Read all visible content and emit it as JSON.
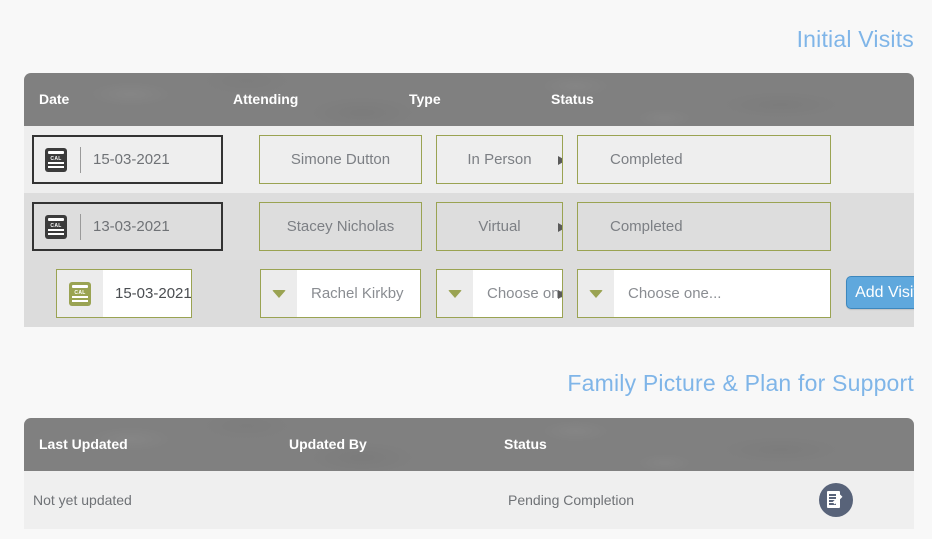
{
  "theme": {
    "page_background": "#f8f8f8",
    "heading_color": "#7fb5e8",
    "table_header_background": "#808080",
    "row_background_odd": "#eeeeee",
    "row_background_even": "#dddddd",
    "field_border_green": "#9aa352",
    "field_border_dark": "#333333",
    "primary_button_background": "#5fa8dd",
    "edit_icon_background": "#586379",
    "text_muted": "#7c7f84"
  },
  "initial_visits": {
    "heading": "Initial Visits",
    "columns": [
      "Date",
      "Attending",
      "Type",
      "Status"
    ],
    "rows": [
      {
        "date": "15-03-2021",
        "attending": "Simone Dutton",
        "type": "In Person",
        "status": "Completed",
        "date_icon": "calendar-icon",
        "date_icon_label": "CAL"
      },
      {
        "date": "13-03-2021",
        "attending": "Stacey Nicholas",
        "type": "Virtual",
        "status": "Completed",
        "date_icon": "calendar-icon",
        "date_icon_label": "CAL"
      }
    ],
    "new_row": {
      "date": "15-03-2021",
      "date_icon": "calendar-icon",
      "date_icon_label": "CAL",
      "attending": "Rachel Kirkby",
      "type": "Choose one",
      "status": "Choose one...",
      "dropdown_icon": "chevron-down-icon",
      "add_button_label": "Add Visit"
    }
  },
  "family_picture": {
    "heading": "Family Picture & Plan for Support",
    "columns": [
      "Last Updated",
      "Updated By",
      "Status"
    ],
    "rows": [
      {
        "last_updated": "Not yet updated",
        "updated_by": "",
        "status": "Pending Completion",
        "action_icon": "edit-document-icon"
      }
    ]
  }
}
